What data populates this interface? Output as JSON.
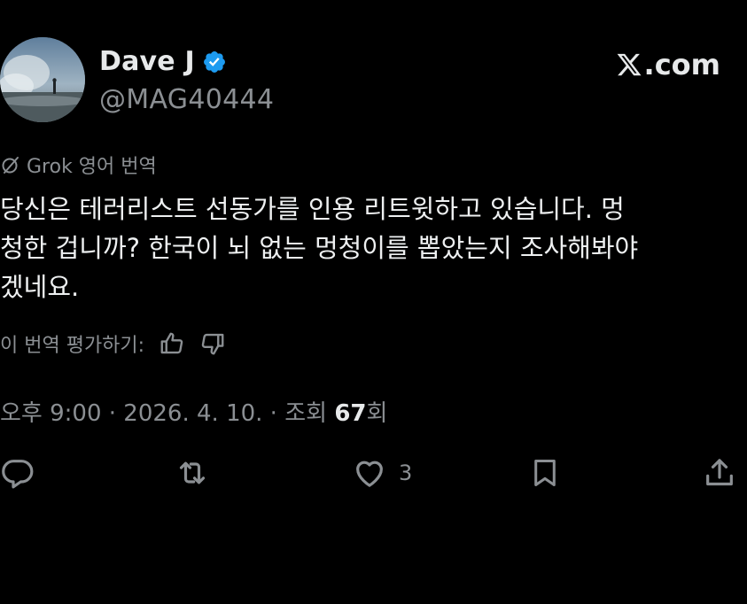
{
  "author": {
    "display_name": "Dave J",
    "handle": "@MAG40444",
    "verified": true,
    "verified_color": "#1d9bf0"
  },
  "brand": {
    "name": ".com"
  },
  "translation": {
    "label": "Grok 영어 번역",
    "icon": "grok-icon"
  },
  "tweet": {
    "lines": [
      "당신은 테러리스트 선동가를 인용 리트윗하고 있습니다. 멍",
      "청한 겁니까? 한국이 뇌 없는 멍청이를 뽑았는지 조사해봐야",
      "겠네요."
    ]
  },
  "rating": {
    "label": "이 번역 평가하기:",
    "thumbs_up_icon": "thumbs-up-icon",
    "thumbs_down_icon": "thumbs-down-icon"
  },
  "meta": {
    "time": "오후 9:00",
    "separator": " · ",
    "date": "2026. 4. 10.",
    "views_label": "조회 ",
    "views_count": "67",
    "views_suffix": "회"
  },
  "actions": {
    "reply_icon": "reply-icon",
    "repost_icon": "repost-icon",
    "like_icon": "heart-icon",
    "like_count": "3",
    "bookmark_icon": "bookmark-icon",
    "share_icon": "share-icon"
  },
  "colors": {
    "background": "#000000",
    "text_primary": "#e7e9ea",
    "text_secondary": "#8b8f93"
  }
}
